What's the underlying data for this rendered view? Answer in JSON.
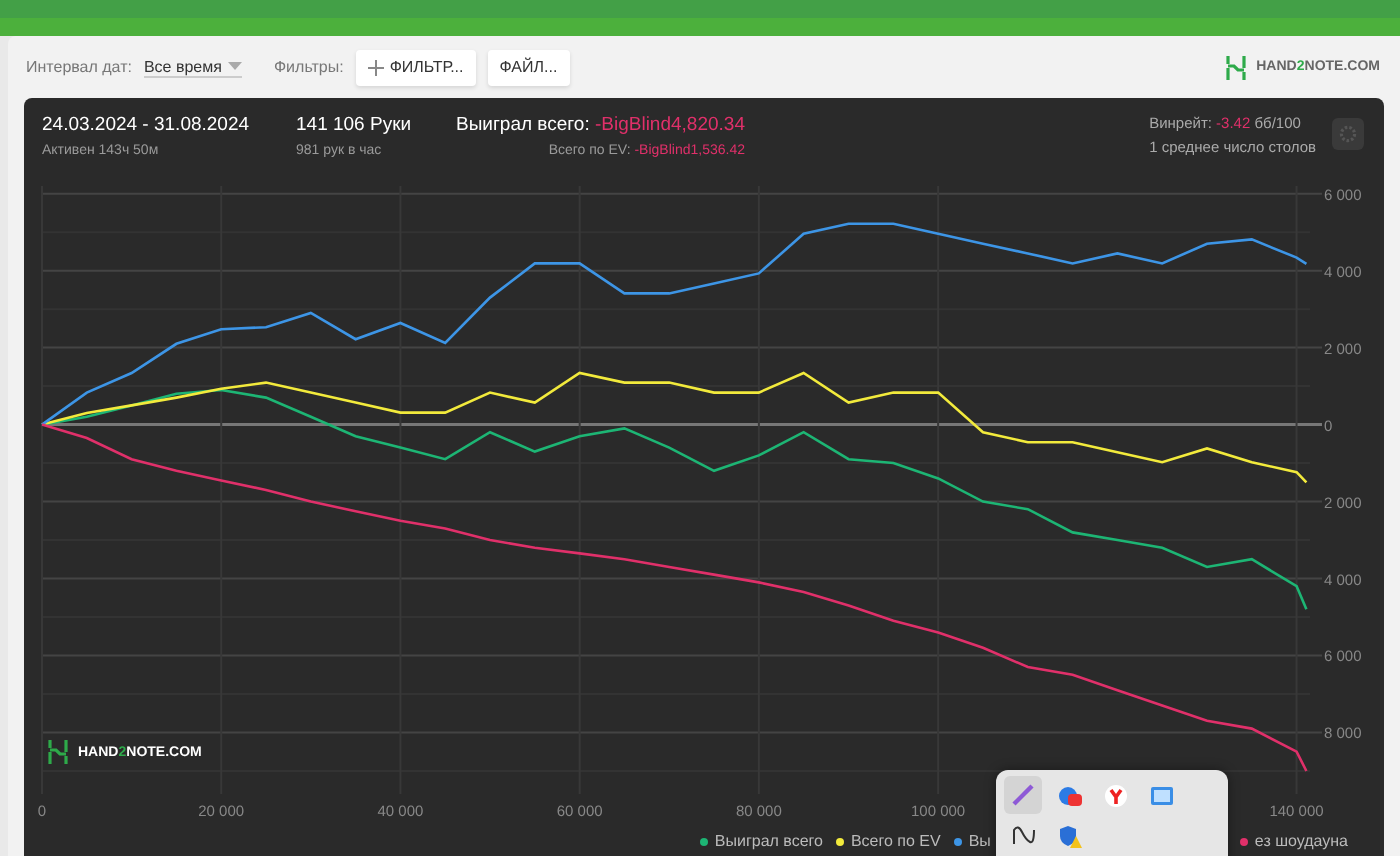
{
  "toolbar": {
    "interval_label": "Интервал дат:",
    "interval_value": "Все время",
    "filters_label": "Фильтры:",
    "buttons": [
      {
        "kind": "add",
        "label": "ФИЛЬТР..."
      },
      {
        "kind": "plain",
        "label": "ФАЙЛ..."
      }
    ]
  },
  "logo": {
    "name": "HAND",
    "digit": "2",
    "rest": "NOTE.COM"
  },
  "summary": {
    "dates": "24.03.2024 - 31.08.2024",
    "active": "Активен 143ч 50м",
    "hands": "141 106 Руки",
    "hands_rate": "981 рук в час",
    "won_label": "Выиграл всего: ",
    "won_value": "-BigBlind4,820.34",
    "ev_label": "Всего по EV: ",
    "ev_value": "-BigBlind1,536.42",
    "winrate_label": "Винрейт: ",
    "winrate_value": "-3.42",
    "winrate_unit": " бб/100",
    "tables": "1 среднее число столов"
  },
  "chart": {
    "watermark": {
      "name": "HAND",
      "digit": "2",
      "rest": "NOTE.COM"
    },
    "chart_data": {
      "type": "line",
      "grid": true,
      "x": [
        0,
        5000,
        10000,
        15000,
        20000,
        25000,
        30000,
        35000,
        40000,
        45000,
        50000,
        55000,
        60000,
        65000,
        70000,
        75000,
        80000,
        85000,
        90000,
        95000,
        100000,
        105000,
        110000,
        115000,
        120000,
        125000,
        130000,
        135000,
        140000,
        141106
      ],
      "series": [
        {
          "name": "Выиграл всего",
          "color": "#1db574",
          "values": [
            0,
            200,
            500,
            800,
            900,
            700,
            200,
            -300,
            -600,
            -900,
            -200,
            -700,
            -300,
            -100,
            -600,
            -1200,
            -800,
            -200,
            -900,
            -1000,
            -1400,
            -2000,
            -2200,
            -2800,
            -3000,
            -3200,
            -3700,
            -3500,
            -4200,
            -4800
          ]
        },
        {
          "name": "Всего по EV",
          "color": "#f2ea3c",
          "values": [
            0,
            300,
            500,
            700,
            930,
            1090,
            830,
            570,
            310,
            310,
            830,
            570,
            1340,
            1090,
            1090,
            830,
            830,
            1340,
            570,
            830,
            830,
            -200,
            -460,
            -460,
            -720,
            -980,
            -620,
            -980,
            -1240,
            -1500
          ]
        },
        {
          "name": "Вы",
          "color": "#3d95e6",
          "values": [
            0,
            830,
            1340,
            2100,
            2480,
            2530,
            2900,
            2220,
            2640,
            2120,
            3300,
            4190,
            4190,
            3410,
            3410,
            3670,
            3930,
            4960,
            5220,
            5220,
            4960,
            4700,
            4450,
            4190,
            4450,
            4190,
            4700,
            4810,
            4340,
            4180
          ]
        },
        {
          "name": "ез шоудауна",
          "color": "#e0306a",
          "values": [
            0,
            -350,
            -900,
            -1200,
            -1450,
            -1700,
            -2000,
            -2250,
            -2500,
            -2700,
            -3000,
            -3200,
            -3350,
            -3500,
            -3700,
            -3900,
            -4100,
            -4350,
            -4700,
            -5100,
            -5400,
            -5800,
            -6300,
            -6500,
            -6900,
            -7300,
            -7700,
            -7900,
            -8500,
            -9000
          ]
        }
      ],
      "xlim": [
        0,
        141500
      ],
      "ylim": [
        -9600,
        6200
      ],
      "xticks": [
        0,
        {
          "value": 20000,
          "label": "20 000"
        },
        {
          "value": 40000,
          "label": "40 000"
        },
        {
          "value": 60000,
          "label": "60 000"
        },
        {
          "value": 80000,
          "label": "80 000"
        },
        {
          "value": 100000,
          "label": "100 000"
        },
        {
          "value": 140000,
          "label": "140 000"
        }
      ],
      "yticks": [
        {
          "value": 6000,
          "label": "6 000"
        },
        {
          "value": 4000,
          "label": "4 000"
        },
        {
          "value": 2000,
          "label": "2 000"
        },
        0,
        {
          "value": -2000,
          "label": "2 000"
        },
        {
          "value": -4000,
          "label": "4 000"
        },
        {
          "value": -6000,
          "label": "6 000"
        },
        {
          "value": -8000,
          "label": "8 000"
        }
      ]
    }
  },
  "tray": {
    "icons": [
      {
        "kind": "pen",
        "selected": true
      },
      {
        "kind": "ball",
        "selected": false
      },
      {
        "kind": "browser",
        "selected": false
      },
      {
        "kind": "screen",
        "selected": false
      },
      {
        "kind": "wave",
        "selected": false
      },
      {
        "kind": "shield",
        "selected": false
      }
    ]
  }
}
